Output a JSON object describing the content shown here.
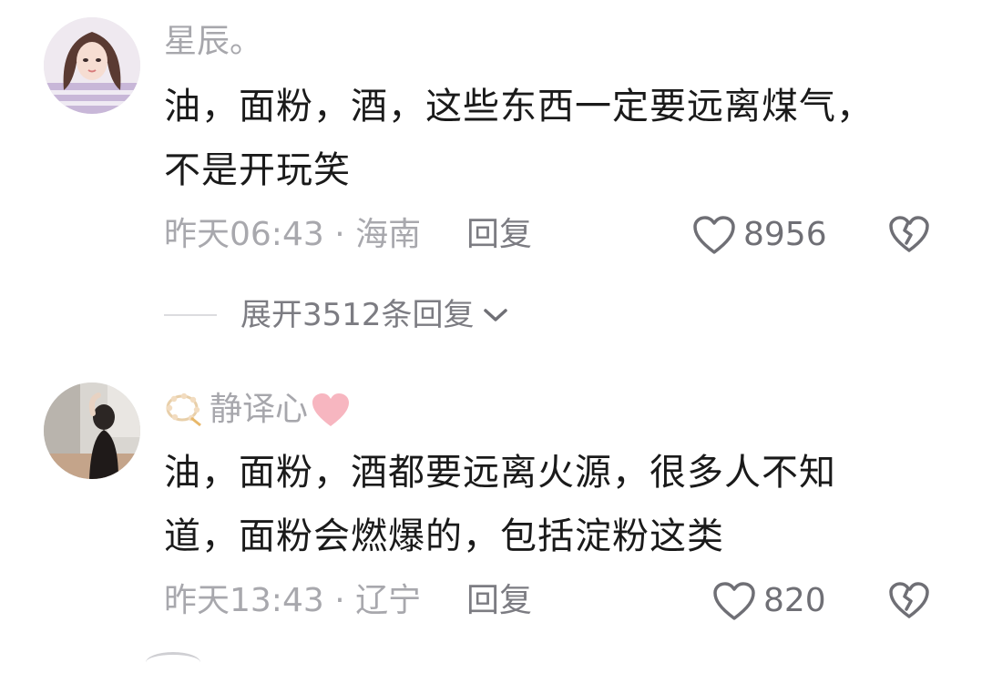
{
  "comments": [
    {
      "username": "星辰。",
      "text": "油，面粉，酒，这些东西一定要远离煤气，不是开玩笑",
      "meta": "昨天06:43 · 海南",
      "reply_label": "回复",
      "likes": "8956",
      "expand_replies": "展开3512条回复"
    },
    {
      "username": "静译心",
      "text": "油，面粉，酒都要远离火源，很多人不知道，面粉会燃爆的，包括淀粉这类",
      "meta": "昨天13:43 · 辽宁",
      "reply_label": "回复",
      "likes": "820"
    }
  ],
  "icons": {
    "like": "heart-outline-icon",
    "dislike": "broken-heart-icon",
    "expand": "chevron-down-icon",
    "username_prefix": "prayer-beads-icon",
    "username_suffix": "pink-heart-icon"
  },
  "colors": {
    "accent_heart": "#f7b6c0",
    "text_primary": "#1a1a1a",
    "text_secondary": "#a8a8ad"
  }
}
